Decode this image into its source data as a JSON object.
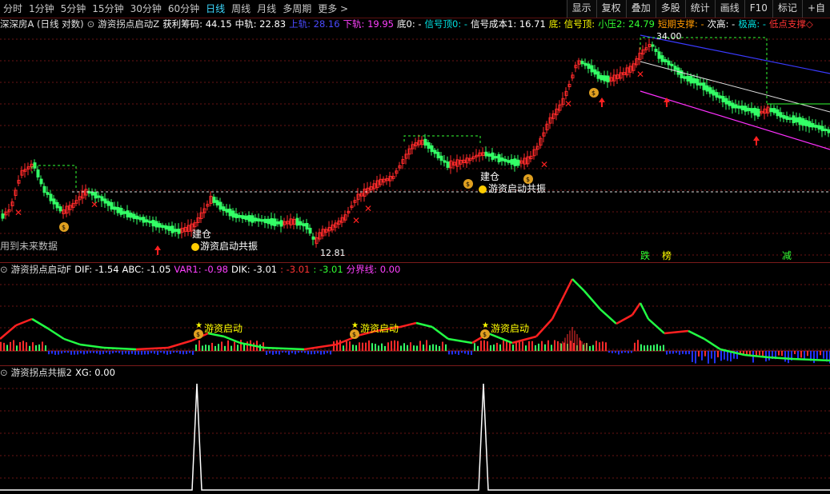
{
  "toolbar": {
    "periods": [
      "分时",
      "1分钟",
      "5分钟",
      "15分钟",
      "30分钟",
      "60分钟",
      "日线",
      "周线",
      "月线",
      "多周期",
      "更多 >"
    ],
    "active": "日线",
    "right": [
      "显示",
      "复权",
      "叠加",
      "多股",
      "统计",
      "画线",
      "F10",
      "标记",
      "+自"
    ]
  },
  "panel1": {
    "stock": "深深房A (日线 对数)",
    "indicator": "游资拐点启动Z",
    "items": [
      {
        "t": "获利筹码: 44.15",
        "c": "#ffffff"
      },
      {
        "t": "中轨: 22.83",
        "c": "#ffffff"
      },
      {
        "t": "上轨: 28.16",
        "c": "#4a4aff"
      },
      {
        "t": "下轨: 19.95",
        "c": "#ff40ff"
      },
      {
        "t": "底0: -",
        "c": "#ffffff"
      },
      {
        "t": "信号顶0: -",
        "c": "#00e0e0"
      },
      {
        "t": "信号成本1: 16.71",
        "c": "#ffffff"
      },
      {
        "t": "底: 信号顶:",
        "c": "#ffff00"
      },
      {
        "t": "小压2: 24.79",
        "c": "#33ff33"
      },
      {
        "t": "短期支撑: -",
        "c": "#ff9900"
      },
      {
        "t": "次高: -",
        "c": "#ffffff"
      },
      {
        "t": "极高: -",
        "c": "#00e0e0"
      },
      {
        "t": "低点支撑◇",
        "c": "#ff3333"
      }
    ],
    "future_text": "用到未来数据",
    "price_high": "34.00",
    "price_low": "12.81",
    "labels_bottom": [
      "跌",
      "榜",
      "减"
    ],
    "annotations": {
      "resonance1": "游资启动共振",
      "resonance2": "游资启动共振",
      "jiancang": "建仓",
      "jiancang2": "建仓"
    }
  },
  "panel2": {
    "indicator": "游资拐点启动F",
    "items": [
      {
        "t": "DIF: -1.54",
        "c": "#ffffff"
      },
      {
        "t": "ABC: -1.05",
        "c": "#ffffff"
      },
      {
        "t": "VAR1: -0.98",
        "c": "#ff40ff"
      },
      {
        "t": "DIK: -3.01",
        "c": "#ffffff"
      },
      {
        "t": ": -3.01",
        "c": "#ff3333"
      },
      {
        "t": ": -3.01",
        "c": "#33ff33"
      },
      {
        "t": "分界线: 0.00",
        "c": "#ff40ff"
      }
    ],
    "start_labels": [
      "游资启动",
      "游资启动",
      "游资启动"
    ]
  },
  "panel3": {
    "indicator": "游资拐点共振2",
    "items": [
      {
        "t": "XG: 0.00",
        "c": "#ffffff"
      }
    ]
  },
  "colors": {
    "up": "#ff2a2a",
    "down": "#33ff66",
    "grid": "#6a1515",
    "accent": "#3dd9ff"
  }
}
